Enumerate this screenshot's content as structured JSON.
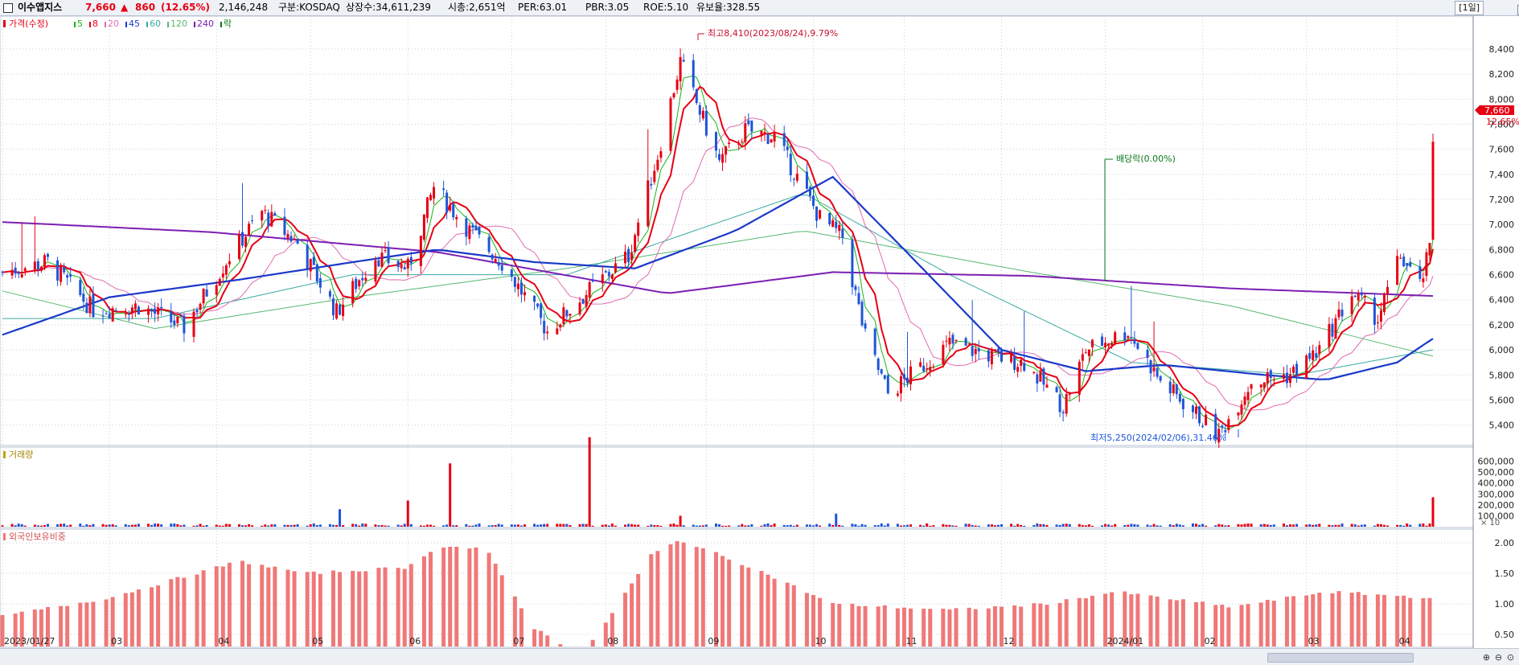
{
  "header": {
    "stock_name": "이수앱지스",
    "price": "7,660",
    "change_arrow": "▲",
    "change": "860",
    "change_pct": "(12.65%)",
    "volume": "2,146,248",
    "market": "구분:KOSDAQ",
    "listed_shares": "상장수:34,611,239",
    "market_cap": "시총:2,651억",
    "per": "PER:63.01",
    "pbr": "PBR:3.05",
    "roe": "ROE:5.10",
    "float_rate": "유보율:328.55",
    "period": "[1일]"
  },
  "legend": {
    "price_title": "가격(수정)",
    "ma_items": [
      {
        "label": "5",
        "color": "#19b319"
      },
      {
        "label": "8",
        "color": "#e60012"
      },
      {
        "label": "20",
        "color": "#e06cb0"
      },
      {
        "label": "45",
        "color": "#1a39c9"
      },
      {
        "label": "60",
        "color": "#3aa9a2"
      },
      {
        "label": "120",
        "color": "#55b870"
      },
      {
        "label": "240",
        "color": "#7b1fb3"
      },
      {
        "label": "락",
        "color": "#0a7a1a"
      }
    ],
    "volume_title": "거래량",
    "foreign_title": "외국인보유비중"
  },
  "colors": {
    "up": "#e60012",
    "down": "#1d55d8",
    "volume_up": "#e60012",
    "volume_down": "#1d55d8",
    "foreign_bar": "#f07878",
    "grid": "#c9ced8"
  },
  "annotations": {
    "high": "최고8,410(2023/08/24),9.79%",
    "low": "최저5,250(2024/02/06),31.46%",
    "dividend": "배당락(0.00%)",
    "current_price_tag": "7,660",
    "current_pct": "12.65%",
    "volume_unit": "× 10"
  },
  "chart_data": [
    {
      "type": "candlestick",
      "x_labels": [
        "2023/01/27",
        "03",
        "04",
        "05",
        "06",
        "07",
        "08",
        "09",
        "10",
        "11",
        "12",
        "2024/01",
        "02",
        "03",
        "04"
      ],
      "y_ticks": [
        5400,
        5600,
        5800,
        6000,
        6200,
        6400,
        6600,
        6800,
        7000,
        7200,
        7400,
        7600,
        7800,
        8000,
        8200,
        8400
      ],
      "ylim": [
        5250,
        8650
      ],
      "anchors": [
        {
          "date": "2023/01/27",
          "close": 6620
        },
        {
          "date": "2023/02/10",
          "close": 6700
        },
        {
          "date": "2023/02/24",
          "close": 6320
        },
        {
          "date": "2023/03/10",
          "close": 6350
        },
        {
          "date": "2023/03/24",
          "close": 6180
        },
        {
          "date": "2023/04/07",
          "close": 6750
        },
        {
          "date": "2023/04/17",
          "close": 7100
        },
        {
          "date": "2023/04/28",
          "close": 6850
        },
        {
          "date": "2023/05/10",
          "close": 6300
        },
        {
          "date": "2023/05/22",
          "close": 6750
        },
        {
          "date": "2023/06/01",
          "close": 6650
        },
        {
          "date": "2023/06/09",
          "close": 7300
        },
        {
          "date": "2023/06/20",
          "close": 6950
        },
        {
          "date": "2023/06/30",
          "close": 6700
        },
        {
          "date": "2023/07/14",
          "close": 6150
        },
        {
          "date": "2023/07/26",
          "close": 6450
        },
        {
          "date": "2023/08/08",
          "close": 6750
        },
        {
          "date": "2023/08/17",
          "close": 7550
        },
        {
          "date": "2023/08/24",
          "close": 8300
        },
        {
          "date": "2023/09/05",
          "close": 7500
        },
        {
          "date": "2023/09/13",
          "close": 7750
        },
        {
          "date": "2023/09/22",
          "close": 7700
        },
        {
          "date": "2023/10/06",
          "close": 7050
        },
        {
          "date": "2023/10/13",
          "close": 6900
        },
        {
          "date": "2023/10/20",
          "close": 6100
        },
        {
          "date": "2023/10/27",
          "close": 5650
        },
        {
          "date": "2023/11/08",
          "close": 5900
        },
        {
          "date": "2023/11/15",
          "close": 6050
        },
        {
          "date": "2023/11/28",
          "close": 5950
        },
        {
          "date": "2023/12/08",
          "close": 5900
        },
        {
          "date": "2023/12/20",
          "close": 5550
        },
        {
          "date": "2023/12/27",
          "close": 6000
        },
        {
          "date": "2024/01/09",
          "close": 6150
        },
        {
          "date": "2024/01/19",
          "close": 5750
        },
        {
          "date": "2024/02/06",
          "close": 5320
        },
        {
          "date": "2024/02/16",
          "close": 5750
        },
        {
          "date": "2024/02/28",
          "close": 5800
        },
        {
          "date": "2024/03/08",
          "close": 6000
        },
        {
          "date": "2024/03/18",
          "close": 6450
        },
        {
          "date": "2024/03/26",
          "close": 6250
        },
        {
          "date": "2024/04/02",
          "close": 6750
        },
        {
          "date": "2024/04/08",
          "close": 6500
        },
        {
          "date": "2024/04/11",
          "close": 6800
        },
        {
          "date": "2024/04/12",
          "close": 7660
        }
      ],
      "moving_averages": {
        "ma45": [
          {
            "date": "2023/01/27",
            "value": 6120
          },
          {
            "date": "2023/03/01",
            "value": 6420
          },
          {
            "date": "2023/04/10",
            "value": 6560
          },
          {
            "date": "2023/05/15",
            "value": 6700
          },
          {
            "date": "2023/06/10",
            "value": 6800
          },
          {
            "date": "2023/07/10",
            "value": 6700
          },
          {
            "date": "2023/08/10",
            "value": 6650
          },
          {
            "date": "2023/09/10",
            "value": 6950
          },
          {
            "date": "2023/10/10",
            "value": 7380
          },
          {
            "date": "2023/11/01",
            "value": 6800
          },
          {
            "date": "2023/12/01",
            "value": 6000
          },
          {
            "date": "2023/12/27",
            "value": 5830
          },
          {
            "date": "2024/01/20",
            "value": 5880
          },
          {
            "date": "2024/02/20",
            "value": 5800
          },
          {
            "date": "2024/03/10",
            "value": 5760
          },
          {
            "date": "2024/04/01",
            "value": 5900
          },
          {
            "date": "2024/04/12",
            "value": 6090
          }
        ],
        "ma240": [
          {
            "date": "2023/01/27",
            "value": 7020
          },
          {
            "date": "2023/04/01",
            "value": 6940
          },
          {
            "date": "2023/06/10",
            "value": 6780
          },
          {
            "date": "2023/08/20",
            "value": 6450
          },
          {
            "date": "2023/10/10",
            "value": 6620
          },
          {
            "date": "2023/12/10",
            "value": 6590
          },
          {
            "date": "2024/02/10",
            "value": 6490
          },
          {
            "date": "2024/04/12",
            "value": 6430
          }
        ],
        "ma120": [
          {
            "date": "2023/01/27",
            "value": 6470
          },
          {
            "date": "2023/03/15",
            "value": 6170
          },
          {
            "date": "2023/05/15",
            "value": 6420
          },
          {
            "date": "2023/07/20",
            "value": 6650
          },
          {
            "date": "2023/10/01",
            "value": 6950
          },
          {
            "date": "2023/12/10",
            "value": 6620
          },
          {
            "date": "2024/02/10",
            "value": 6350
          },
          {
            "date": "2024/04/12",
            "value": 5950
          }
        ],
        "ma60": [
          {
            "date": "2023/01/27",
            "value": 6250
          },
          {
            "date": "2023/03/15",
            "value": 6250
          },
          {
            "date": "2023/05/15",
            "value": 6600
          },
          {
            "date": "2023/07/20",
            "value": 6600
          },
          {
            "date": "2023/10/01",
            "value": 7250
          },
          {
            "date": "2023/11/15",
            "value": 6600
          },
          {
            "date": "2024/01/10",
            "value": 5900
          },
          {
            "date": "2024/03/01",
            "value": 5800
          },
          {
            "date": "2024/04/12",
            "value": 6000
          }
        ]
      },
      "volume_y_ticks": [
        "100,000",
        "200,000",
        "300,000",
        "400,000",
        "500,000",
        "600,000"
      ],
      "volume_spikes": [
        {
          "date": "2023/03/01",
          "value": 20000
        },
        {
          "date": "2023/05/11",
          "value": 160000
        },
        {
          "date": "2023/06/01",
          "value": 240000
        },
        {
          "date": "2023/06/14",
          "value": 580000
        },
        {
          "date": "2023/07/27",
          "value": 820000
        },
        {
          "date": "2023/08/24",
          "value": 100000
        },
        {
          "date": "2023/10/11",
          "value": 120000
        },
        {
          "date": "2024/04/12",
          "value": 270000
        }
      ],
      "foreign_y_ticks": [
        "0.50",
        "1.00",
        "1.50",
        "2.00"
      ],
      "foreign_ratio": [
        {
          "date": "2023/01/27",
          "value": 0.8
        },
        {
          "date": "2023/03/01",
          "value": 1.1
        },
        {
          "date": "2023/04/10",
          "value": 1.7
        },
        {
          "date": "2023/05/01",
          "value": 1.5
        },
        {
          "date": "2023/06/01",
          "value": 1.6
        },
        {
          "date": "2023/06/10",
          "value": 1.95
        },
        {
          "date": "2023/06/25",
          "value": 1.9
        },
        {
          "date": "2023/07/10",
          "value": 0.6
        },
        {
          "date": "2023/07/25",
          "value": 0.15
        },
        {
          "date": "2023/08/15",
          "value": 1.8
        },
        {
          "date": "2023/08/24",
          "value": 2.05
        },
        {
          "date": "2023/09/15",
          "value": 1.6
        },
        {
          "date": "2023/10/10",
          "value": 1.0
        },
        {
          "date": "2023/11/15",
          "value": 0.9
        },
        {
          "date": "2023/12/15",
          "value": 1.0
        },
        {
          "date": "2024/01/05",
          "value": 1.2
        },
        {
          "date": "2024/02/10",
          "value": 0.95
        },
        {
          "date": "2024/03/10",
          "value": 1.2
        },
        {
          "date": "2024/04/12",
          "value": 1.1
        }
      ]
    }
  ]
}
